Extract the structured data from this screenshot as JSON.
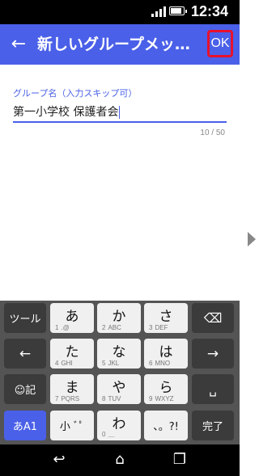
{
  "status": {
    "time": "12:34"
  },
  "appbar": {
    "back_icon": "←",
    "title": "新しいグループメッセ…",
    "ok_label": "OK"
  },
  "form": {
    "label": "グループ名（入力スキップ可）",
    "value": "第一小学校 保護者会",
    "counter": "10 / 50"
  },
  "keyboard": {
    "tool_label": "ツール",
    "emoji_label": "☺記",
    "mode_label": "あA1",
    "done_label": "完了",
    "left_arrow": "←",
    "right_arrow": "→",
    "backspace_icon": "⌫",
    "space_icon": "␣",
    "keys": [
      {
        "main": "あ",
        "sub": "1",
        "sub2": ".@"
      },
      {
        "main": "か",
        "sub": "2",
        "sub2": "ABC"
      },
      {
        "main": "さ",
        "sub": "3",
        "sub2": "DEF"
      },
      {
        "main": "た",
        "sub": "4",
        "sub2": "GHI"
      },
      {
        "main": "な",
        "sub": "5",
        "sub2": "JKL"
      },
      {
        "main": "は",
        "sub": "6",
        "sub2": "MNO"
      },
      {
        "main": "ま",
        "sub": "7",
        "sub2": "PQRS"
      },
      {
        "main": "や",
        "sub": "8",
        "sub2": "TUV"
      },
      {
        "main": "ら",
        "sub": "9",
        "sub2": "WXYZ"
      },
      {
        "main": "小 ﾞﾟ"
      },
      {
        "main": "わ",
        "sub": "0",
        "sub2": "＿"
      },
      {
        "main": "、。?!"
      }
    ]
  },
  "navbar": {
    "back": "↩",
    "home": "⌂",
    "recents": "❐"
  }
}
